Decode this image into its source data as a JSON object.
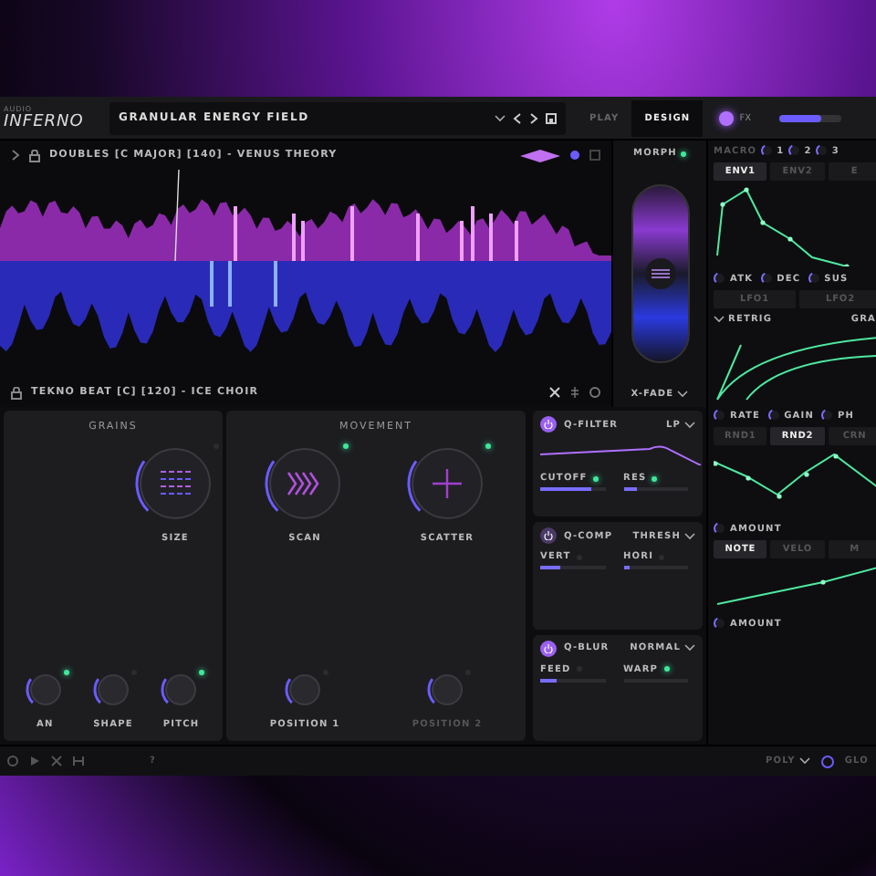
{
  "header": {
    "brand_small": "AUDIO",
    "brand": "INFERNO",
    "preset": "GRANULAR ENERGY FIELD",
    "modes": [
      {
        "label": "PLAY",
        "selected": false
      },
      {
        "label": "DESIGN",
        "selected": true
      }
    ],
    "fx": {
      "label": "FX",
      "on": true
    },
    "volume": {
      "level": 0.7
    }
  },
  "sample_a": {
    "name": "DOUBLES [C MAJOR] [140] - VENUS THEORY"
  },
  "sample_b": {
    "name": "TEKNO BEAT [C] [120] - ICE CHOIR"
  },
  "morph": {
    "label": "MORPH",
    "on": true,
    "mode": "X-FADE",
    "level": 0.5
  },
  "grains": {
    "title": "GRAINS",
    "big_knobs": [
      {
        "label": "SIZE",
        "on": false,
        "kind": "grid"
      }
    ],
    "small_knobs": [
      {
        "label": "AN",
        "on": true
      },
      {
        "label": "SHAPE",
        "on": false
      },
      {
        "label": "PITCH",
        "on": true
      }
    ]
  },
  "movement": {
    "title": "MOVEMENT",
    "big_knobs": [
      {
        "label": "SCAN",
        "on": true,
        "kind": "chevrons"
      },
      {
        "label": "SCATTER",
        "on": true,
        "kind": "cross"
      }
    ],
    "small_knobs": [
      {
        "label": "POSITION 1",
        "on": false
      },
      {
        "label": "POSITION 2",
        "on": false,
        "disabled": true
      }
    ]
  },
  "effects": [
    {
      "name": "Q-FILTER",
      "mode": "LP",
      "on": true,
      "kind": "filter",
      "params": [
        {
          "label": "CUTOFF",
          "level": 0.8,
          "on": true
        },
        {
          "label": "RES",
          "level": 0.2,
          "on": true
        }
      ]
    },
    {
      "name": "Q-COMP",
      "mode": "THRESH",
      "on": false,
      "kind": "comp",
      "params": [
        {
          "label": "VERT",
          "level": 0.3,
          "on": false
        },
        {
          "label": "HORI",
          "level": 0.1,
          "on": false
        }
      ]
    },
    {
      "name": "Q-BLUR",
      "mode": "NORMAL",
      "on": true,
      "kind": "blur",
      "params": [
        {
          "label": "FEED",
          "level": 0.25,
          "on": false
        },
        {
          "label": "WARP",
          "level": 0,
          "on": true
        }
      ]
    }
  ],
  "macros": {
    "label": "MACRO",
    "items": [
      {
        "label": "1"
      },
      {
        "label": "2"
      },
      {
        "label": "3"
      }
    ]
  },
  "env": {
    "tabs": [
      {
        "label": "ENV1",
        "selected": true
      },
      {
        "label": "ENV2",
        "selected": false
      },
      {
        "label": "E",
        "selected": false
      }
    ],
    "knobs": [
      {
        "label": "ATK"
      },
      {
        "label": "DEC"
      },
      {
        "label": "SUS"
      }
    ]
  },
  "lfo": {
    "tabs": [
      {
        "label": "LFO1",
        "selected": false
      },
      {
        "label": "LFO2",
        "selected": false
      }
    ],
    "retrig": "RETRIG",
    "shape": "GRA",
    "knobs": [
      {
        "label": "RATE"
      },
      {
        "label": "GAIN"
      },
      {
        "label": "PH"
      }
    ]
  },
  "rnd": {
    "tabs": [
      {
        "label": "RND1",
        "selected": false
      },
      {
        "label": "RND2",
        "selected": true
      },
      {
        "label": "CRN",
        "selected": false
      }
    ],
    "knobs": [
      {
        "label": "AMOUNT"
      }
    ]
  },
  "note": {
    "tabs": [
      {
        "label": "NOTE",
        "selected": true
      },
      {
        "label": "VELO",
        "selected": false
      },
      {
        "label": "M",
        "selected": false
      }
    ],
    "knobs": [
      {
        "label": "AMOUNT"
      }
    ]
  },
  "footer": {
    "help": "?",
    "voice_mode": "POLY",
    "glide": "GLO"
  }
}
